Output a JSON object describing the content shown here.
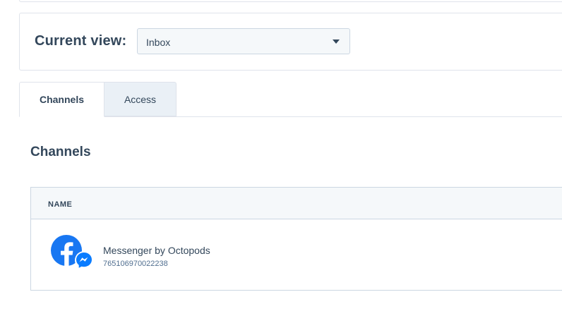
{
  "view": {
    "label": "Current view:",
    "selected": "Inbox"
  },
  "tabs": [
    {
      "label": "Channels",
      "active": true
    },
    {
      "label": "Access",
      "active": false
    }
  ],
  "section": {
    "title": "Channels"
  },
  "table": {
    "columns": [
      "NAME"
    ],
    "rows": [
      {
        "name": "Messenger by Octopods",
        "id": "765106970022238",
        "icon": "facebook-messenger-icon"
      }
    ]
  },
  "colors": {
    "text": "#33475b",
    "border": "#dfe3eb",
    "tab_inactive_bg": "#eaf0f6",
    "facebook_blue": "#1877f2",
    "messenger_blue": "#0a7cff"
  }
}
